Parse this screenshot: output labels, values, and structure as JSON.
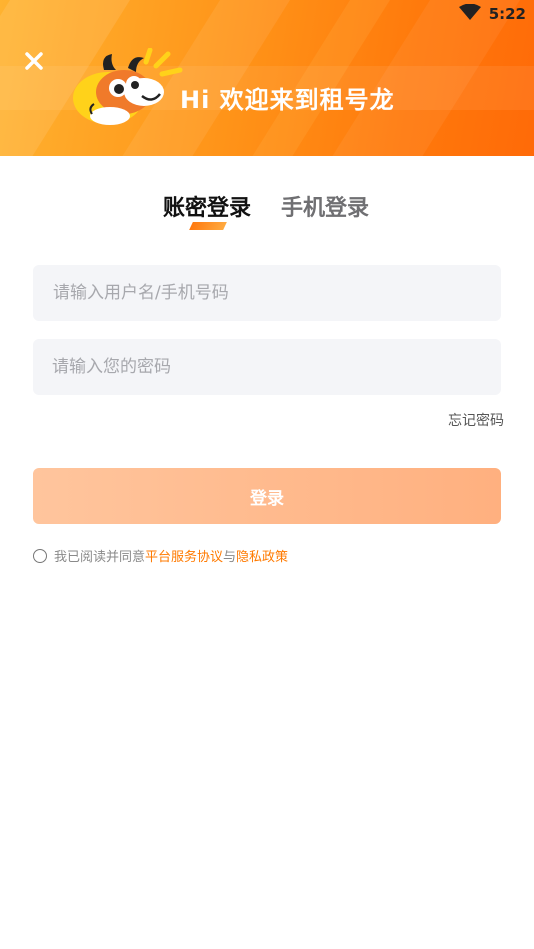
{
  "status_bar": {
    "time": "5:22",
    "wifi_icon": "wifi-icon"
  },
  "header": {
    "close_icon": "close-icon",
    "title": "Hi 欢迎来到租号龙",
    "mascot": "dragon-mascot-logo",
    "gradient_colors": [
      "#ffb330",
      "#ff6a08"
    ]
  },
  "tabs": [
    {
      "label": "账密登录",
      "active": true
    },
    {
      "label": "手机登录",
      "active": false
    }
  ],
  "form": {
    "username_placeholder": "请输入用户名/手机号码",
    "username_value": "",
    "password_placeholder": "请输入您的密码",
    "password_value": "",
    "forgot_label": "忘记密码",
    "login_label": "登录"
  },
  "agreement": {
    "checked": false,
    "prefix": "我已阅读并同意",
    "link1": "平台服务协议",
    "middle": "与",
    "link2": "隐私政策"
  },
  "colors": {
    "accent": "#ff7a00",
    "button": "#ffb98c",
    "input_bg": "#f4f5f8"
  }
}
